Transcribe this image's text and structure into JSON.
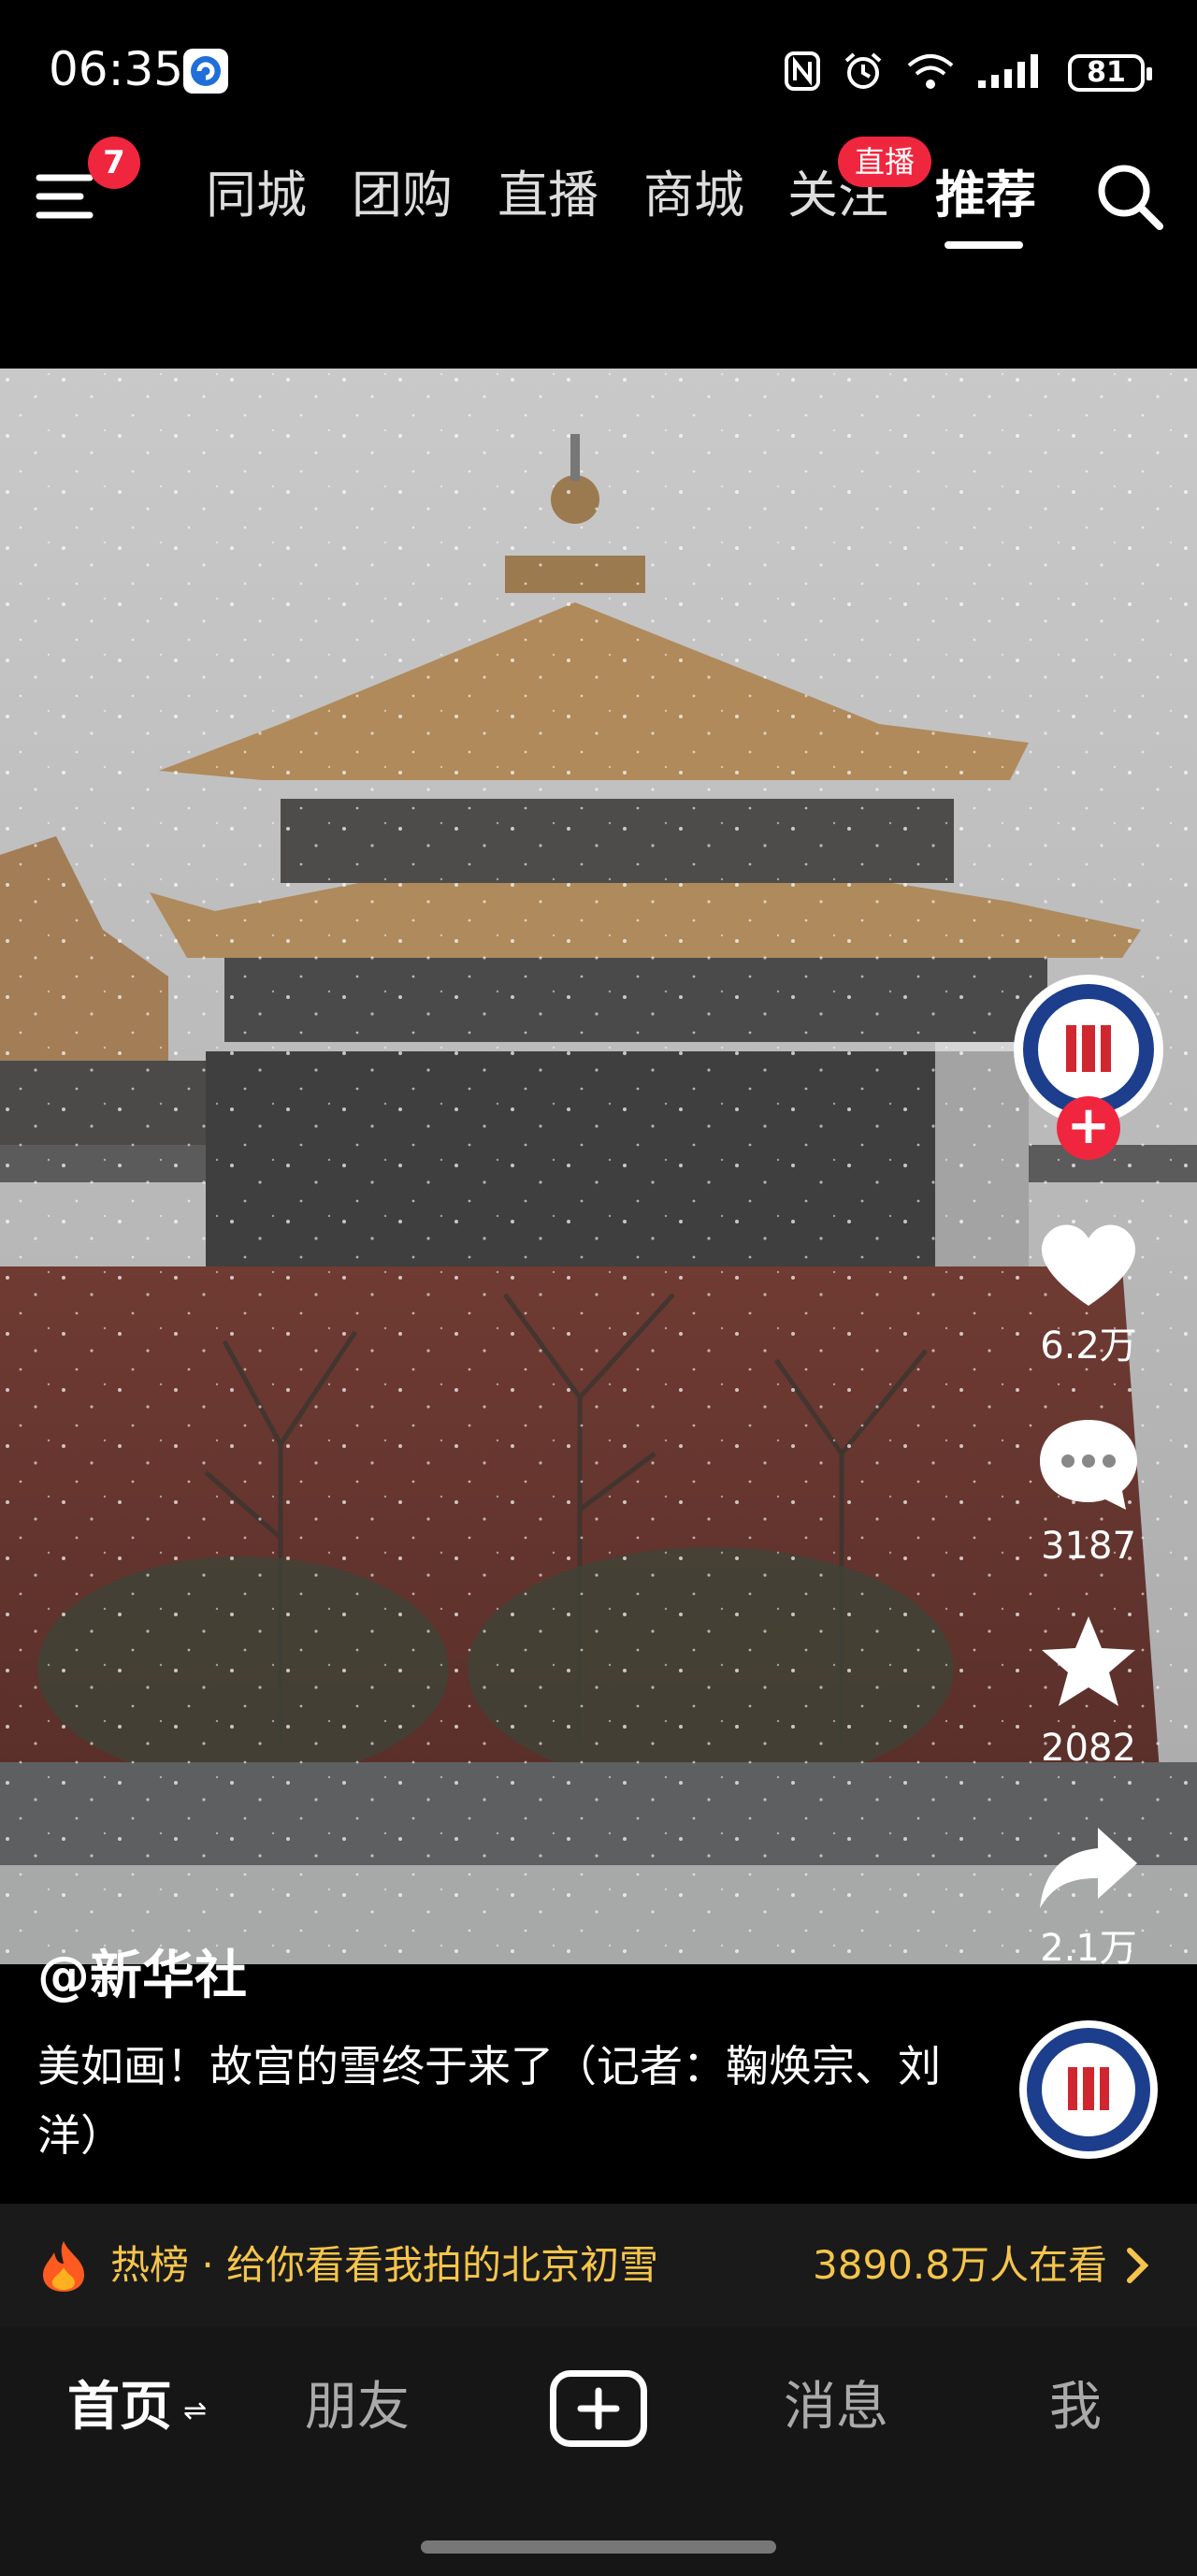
{
  "status_bar": {
    "time": "06:35",
    "battery": "81",
    "icons": [
      "app-notification-icon",
      "nfc-icon",
      "alarm-icon",
      "wifi-icon",
      "signal-icon",
      "battery-icon"
    ]
  },
  "top_nav": {
    "menu_badge": "7",
    "tabs": [
      "同城",
      "团购",
      "直播",
      "商城",
      "关注",
      "推荐"
    ],
    "active_tab": "推荐",
    "live_badge": "直播"
  },
  "video": {
    "likes": "6.2万",
    "comments": "3187",
    "favorites": "2082",
    "shares": "2.1万"
  },
  "post": {
    "author": "@新华社",
    "caption": "美如画！故宫的雪终于来了（记者：鞠焕宗、刘洋）"
  },
  "hot_bar": {
    "text": "热榜 · 给你看看我拍的北京初雪",
    "viewers": "3890.8万人在看"
  },
  "bottom_nav": {
    "home": "首页",
    "friends": "朋友",
    "messages": "消息",
    "me": "我"
  },
  "colors": {
    "accent_red": "#f0263f",
    "hot_yellow": "#f5c54a",
    "sky": "#bdbdbd",
    "roof": "#b08a5a",
    "wall": "#6e3a32"
  }
}
